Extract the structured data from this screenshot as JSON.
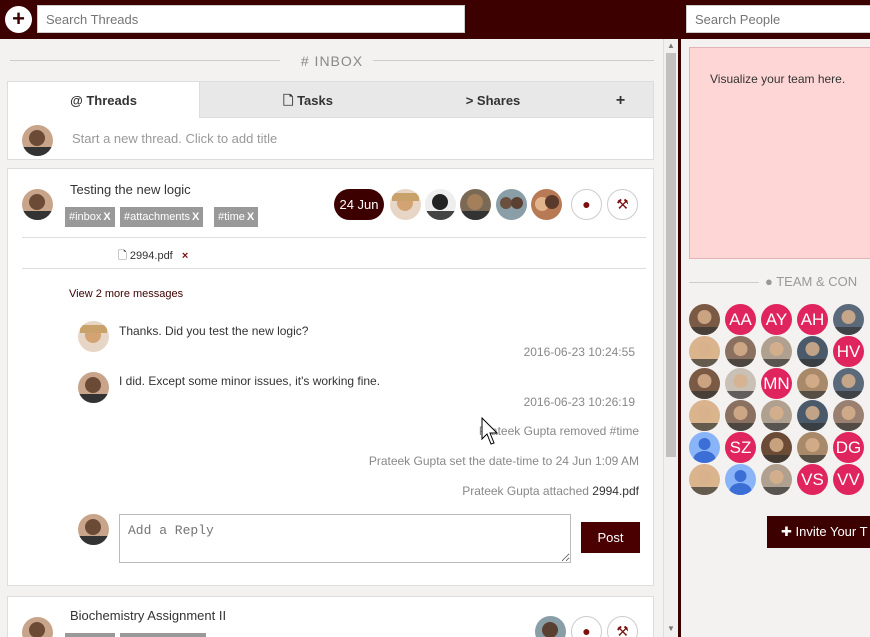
{
  "topbar": {
    "add_label": "+",
    "search_threads_placeholder": "Search Threads",
    "search_people_placeholder": "Search People"
  },
  "inbox": {
    "title": "#  INBOX"
  },
  "tabs": [
    {
      "icon": "at-icon",
      "label": "@ Threads",
      "active": true
    },
    {
      "icon": "clipboard-icon",
      "label": "Tasks",
      "active": false
    },
    {
      "icon": "share-icon",
      "label": "Shares",
      "active": false
    },
    {
      "icon": "plus-icon",
      "label": "+",
      "active": false
    }
  ],
  "new_thread": {
    "placeholder": "Start a new thread. Click to add title"
  },
  "threads": [
    {
      "title": "Testing the new logic",
      "tags": [
        "#inbox",
        "#attachments",
        "#time"
      ],
      "tag_remove": "X",
      "date": "24 Jun",
      "attachment": "2994.pdf",
      "attachment_remove": "×",
      "more_messages": "View 2 more messages",
      "messages": [
        {
          "text": "Thanks. Did you test the new logic?",
          "time": "2016-06-23 10:24:55"
        },
        {
          "text": "I did. Except some minor issues, it's working fine.",
          "time": "2016-06-23 10:26:19"
        }
      ],
      "activity": [
        {
          "text": "Prateek Gupta removed #time"
        },
        {
          "text": "Prateek Gupta set the date-time to 24 Jun 1:09 AM"
        },
        {
          "text": "Prateek Gupta attached ",
          "file": "2994.pdf"
        }
      ],
      "reply_placeholder": "Add a Reply",
      "post_label": "Post"
    },
    {
      "title": "Biochemistry Assignment II"
    }
  ],
  "right_panel": {
    "visualize_text": "Visualize your team here.",
    "team_label": "TEAM & CON",
    "members": [
      "",
      "AA",
      "AY",
      "AH",
      "",
      "",
      "",
      "",
      "",
      "HV",
      "",
      "",
      "MN",
      "",
      "",
      "",
      "",
      "",
      "",
      "",
      "",
      "SZ",
      "",
      "",
      "DG",
      "",
      "",
      "",
      "VS",
      "VV"
    ],
    "invite_label": "Invite Your T"
  },
  "colors": {
    "brand": "#3d0000",
    "initials_bg": "#e0245e",
    "visualize_bg": "#ffd6d6"
  }
}
